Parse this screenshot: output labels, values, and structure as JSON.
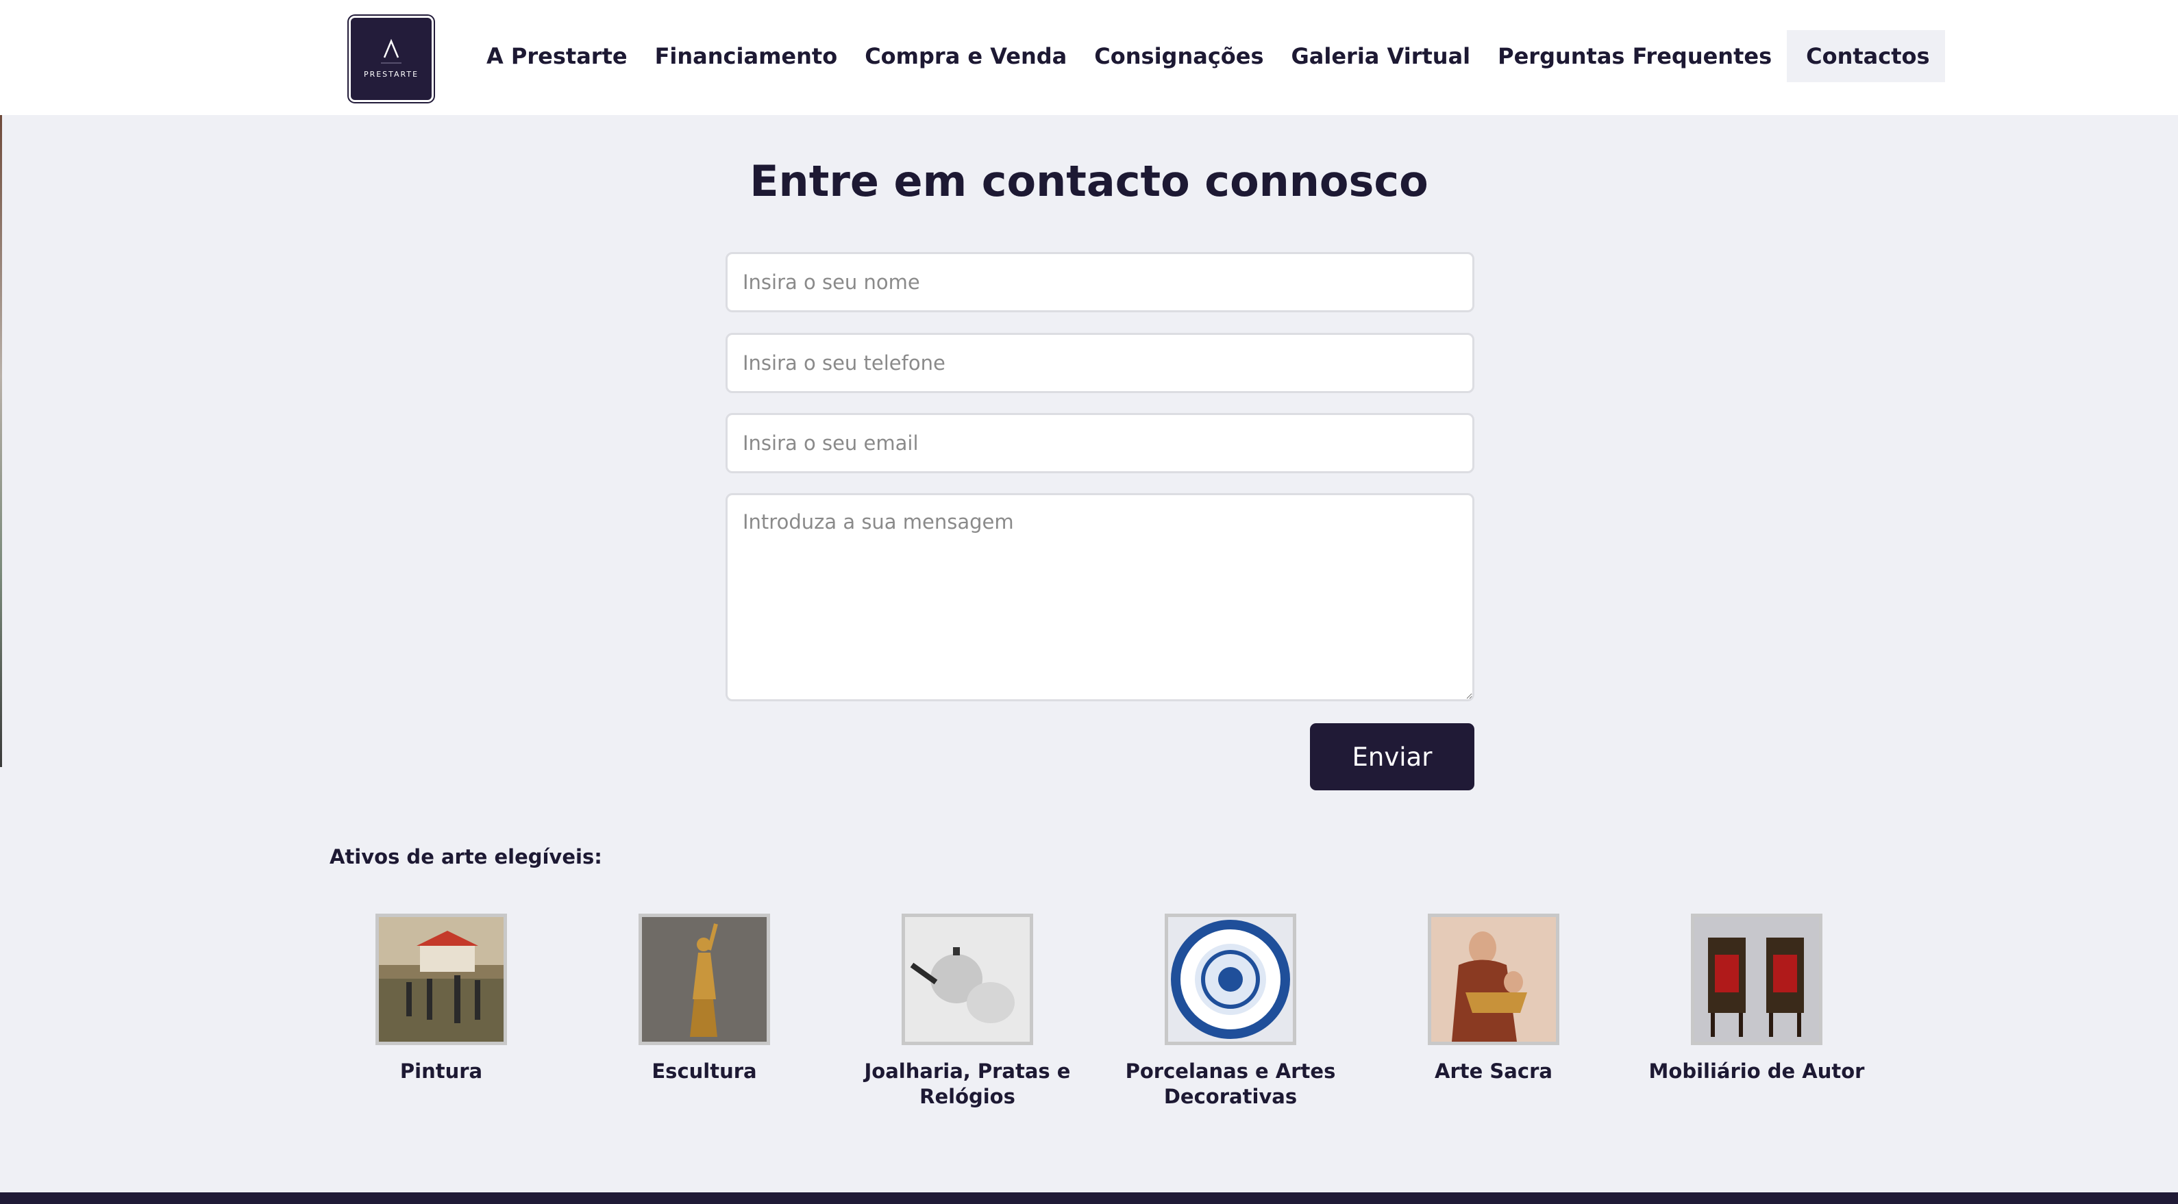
{
  "brand": {
    "logo_text": "PRESTARTE",
    "accent": "#201a36",
    "background": "#eff0f5"
  },
  "nav": {
    "items": [
      {
        "label": "A Prestarte"
      },
      {
        "label": "Financiamento"
      },
      {
        "label": "Compra e Venda"
      },
      {
        "label": "Consignações"
      },
      {
        "label": "Galeria Virtual"
      },
      {
        "label": "Perguntas Frequentes"
      },
      {
        "label": "Contactos",
        "active": true
      }
    ]
  },
  "contact": {
    "title": "Entre em contacto connosco",
    "name_placeholder": "Insira o seu nome",
    "phone_placeholder": "Insira o seu telefone",
    "email_placeholder": "Insira o seu email",
    "message_placeholder": "Introduza a sua mensagem",
    "send_label": "Enviar"
  },
  "assets": {
    "heading": "Ativos de arte elegíveis:",
    "items": [
      {
        "label": "Pintura"
      },
      {
        "label": "Escultura"
      },
      {
        "label": "Joalharia, Pratas e Relógios"
      },
      {
        "label": "Porcelanas e Artes Decorativas"
      },
      {
        "label": "Arte Sacra"
      },
      {
        "label": "Mobiliário de Autor"
      }
    ]
  }
}
